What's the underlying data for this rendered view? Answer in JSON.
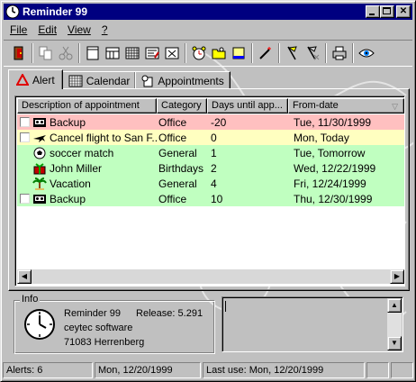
{
  "window": {
    "title": "Reminder 99"
  },
  "menu": [
    {
      "label": "File",
      "key": "F"
    },
    {
      "label": "Edit",
      "key": "E"
    },
    {
      "label": "View",
      "key": "V"
    },
    {
      "label": "?",
      "key": "?"
    }
  ],
  "toolbar": {
    "icons": [
      "exit-door-icon",
      "copy-icon",
      "cut-icon",
      "new-icon",
      "week-view-icon",
      "month-view-icon",
      "edit-icon",
      "delete-icon",
      "alarm-icon",
      "folder-icon",
      "note-icon",
      "wand-icon",
      "flag-icon",
      "flag-x-icon",
      "print-icon",
      "eye-icon"
    ]
  },
  "tabs": [
    {
      "label": "Alert",
      "icon": "alert-triangle-icon",
      "active": true
    },
    {
      "label": "Calendar",
      "icon": "calendar-grid-icon",
      "active": false
    },
    {
      "label": "Appointments",
      "icon": "appointment-icon",
      "active": false
    }
  ],
  "table": {
    "columns": [
      "Description of appointment",
      "Category",
      "Days until app...",
      "From-date"
    ],
    "rows": [
      {
        "desc": "Backup",
        "category": "Office",
        "days": "-20",
        "date": "Tue, 11/30/1999",
        "color": "red",
        "checkbox": true,
        "icon": "tape-icon"
      },
      {
        "desc": "Cancel flight to San F...",
        "category": "Office",
        "days": "0",
        "date": "Mon, Today",
        "color": "yellow",
        "checkbox": true,
        "icon": "airplane-icon"
      },
      {
        "desc": "soccer match",
        "category": "General",
        "days": "1",
        "date": "Tue, Tomorrow",
        "color": "green",
        "checkbox": false,
        "icon": "soccer-ball-icon"
      },
      {
        "desc": "John Miller",
        "category": "Birthdays",
        "days": "2",
        "date": "Wed, 12/22/1999",
        "color": "green",
        "checkbox": false,
        "icon": "gift-icon"
      },
      {
        "desc": "Vacation",
        "category": "General",
        "days": "4",
        "date": "Fri, 12/24/1999",
        "color": "green",
        "checkbox": false,
        "icon": "palm-tree-icon"
      },
      {
        "desc": "Backup",
        "category": "Office",
        "days": "10",
        "date": "Thu, 12/30/1999",
        "color": "green",
        "checkbox": true,
        "icon": "tape-icon"
      }
    ]
  },
  "info": {
    "label": "Info",
    "product": "Reminder 99",
    "release_label": "Release:",
    "release": "5.291",
    "company": "ceytec software",
    "address": "71083 Herrenberg"
  },
  "status": {
    "alerts": "Alerts: 6",
    "date": "Mon, 12/20/1999",
    "last_use": "Last use: Mon, 12/20/1999"
  },
  "colors": {
    "red_row": "#ffc0c0",
    "yellow_row": "#ffffc0",
    "green_row": "#c0ffc0",
    "titlebar": "#000080"
  }
}
